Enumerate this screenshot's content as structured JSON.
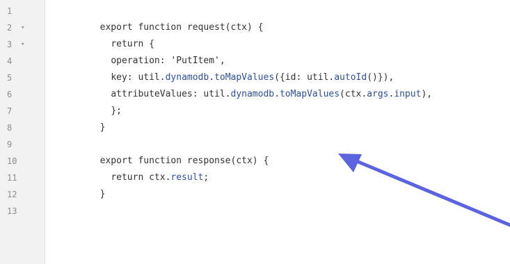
{
  "editor": {
    "lines": [
      {
        "num": "1",
        "fold": "",
        "indent": "",
        "tokens": []
      },
      {
        "num": "2",
        "fold": "▾",
        "indent": "  ",
        "tokens": [
          {
            "t": "export function request(ctx) {",
            "c": "p"
          }
        ]
      },
      {
        "num": "3",
        "fold": "▾",
        "indent": "    ",
        "tokens": [
          {
            "t": "return {",
            "c": "p"
          }
        ]
      },
      {
        "num": "4",
        "fold": "",
        "indent": "    ",
        "tokens": [
          {
            "t": "operation: 'PutItem',",
            "c": "p"
          }
        ]
      },
      {
        "num": "5",
        "fold": "",
        "indent": "    ",
        "tokens": [
          {
            "t": "key: util.",
            "c": "p"
          },
          {
            "t": "dynamodb",
            "c": "m"
          },
          {
            "t": ".",
            "c": "p"
          },
          {
            "t": "toMapValues",
            "c": "m"
          },
          {
            "t": "({id: util.",
            "c": "p"
          },
          {
            "t": "autoId",
            "c": "m"
          },
          {
            "t": "()}),",
            "c": "p"
          }
        ]
      },
      {
        "num": "6",
        "fold": "",
        "indent": "    ",
        "tokens": [
          {
            "t": "attributeValues: util.",
            "c": "p"
          },
          {
            "t": "dynamodb",
            "c": "m"
          },
          {
            "t": ".",
            "c": "p"
          },
          {
            "t": "toMapValues",
            "c": "m"
          },
          {
            "t": "(ctx.",
            "c": "p"
          },
          {
            "t": "args",
            "c": "m"
          },
          {
            "t": ".",
            "c": "p"
          },
          {
            "t": "input",
            "c": "m"
          },
          {
            "t": "),",
            "c": "p"
          }
        ]
      },
      {
        "num": "7",
        "fold": "",
        "indent": "    ",
        "tokens": [
          {
            "t": "};",
            "c": "p"
          }
        ]
      },
      {
        "num": "8",
        "fold": "",
        "indent": "  ",
        "tokens": [
          {
            "t": "}",
            "c": "p"
          }
        ]
      },
      {
        "num": "9",
        "fold": "",
        "indent": "",
        "tokens": []
      },
      {
        "num": "10",
        "fold": "",
        "indent": "  ",
        "tokens": [
          {
            "t": "export function response(ctx) {",
            "c": "p"
          }
        ]
      },
      {
        "num": "11",
        "fold": "",
        "indent": "    ",
        "tokens": [
          {
            "t": "return ctx.",
            "c": "p"
          },
          {
            "t": "result",
            "c": "m"
          },
          {
            "t": ";",
            "c": "p"
          }
        ]
      },
      {
        "num": "12",
        "fold": "",
        "indent": "  ",
        "tokens": [
          {
            "t": "}",
            "c": "p"
          }
        ]
      },
      {
        "num": "13",
        "fold": "",
        "indent": "",
        "tokens": []
      }
    ]
  },
  "colors": {
    "gutter_bg": "#f2f2f2",
    "text": "#333333",
    "member": "#2c4fa3",
    "arrow": "#5b63e0"
  },
  "annotation": {
    "icon": "arrow-icon"
  }
}
